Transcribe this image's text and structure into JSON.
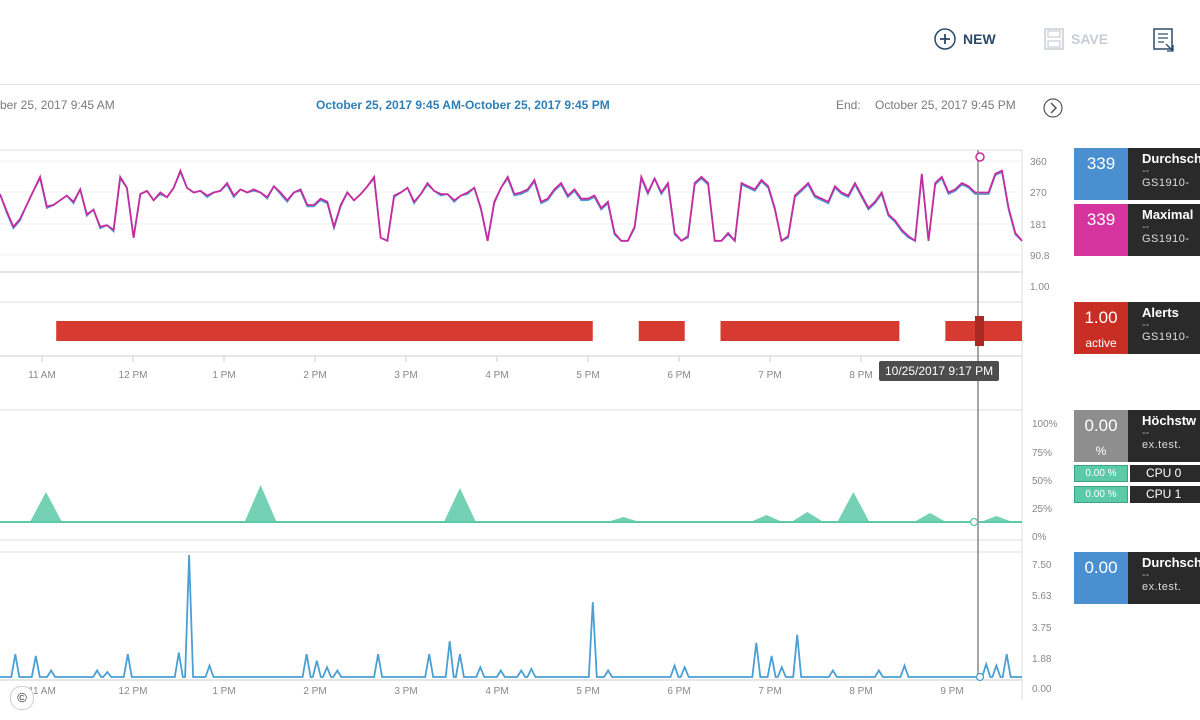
{
  "toolbar": {
    "new_label": "NEW",
    "save_label": "SAVE"
  },
  "timerange": {
    "start_text": "ber 25, 2017 9:45 AM",
    "center_text": "October 25, 2017 9:45 AM-October 25, 2017 9:45 PM",
    "end_label": "End:",
    "end_text": "October 25, 2017 9:45 PM"
  },
  "charts": {
    "metric": {
      "y_ticks": [
        "360",
        "270",
        "181",
        "90.8"
      ],
      "alerts_tick": "1.00",
      "avg_color": "#4a9fd4",
      "max_color": "#c62ba0",
      "avg_values": [
        250,
        190,
        140,
        165,
        215,
        260,
        300,
        205,
        215,
        230,
        245,
        220,
        265,
        180,
        200,
        140,
        150,
        130,
        300,
        270,
        110,
        250,
        260,
        230,
        250,
        240,
        270,
        320,
        270,
        255,
        260,
        240,
        255,
        260,
        280,
        240,
        265,
        255,
        260,
        255,
        235,
        275,
        250,
        225,
        255,
        260,
        210,
        210,
        230,
        220,
        140,
        210,
        255,
        230,
        250,
        275,
        300,
        110,
        100,
        240,
        255,
        270,
        220,
        250,
        280,
        260,
        245,
        250,
        225,
        245,
        250,
        270,
        200,
        100,
        220,
        270,
        300,
        245,
        250,
        260,
        290,
        220,
        230,
        260,
        280,
        240,
        260,
        230,
        230,
        240,
        200,
        220,
        120,
        100,
        100,
        140,
        300,
        250,
        300,
        250,
        280,
        120,
        100,
        110,
        280,
        300,
        280,
        100,
        100,
        120,
        100,
        280,
        270,
        260,
        290,
        270,
        200,
        100,
        110,
        240,
        260,
        280,
        240,
        230,
        220,
        270,
        250,
        240,
        280,
        240,
        200,
        220,
        250,
        180,
        160,
        130,
        110,
        100,
        310,
        100,
        280,
        300,
        250,
        260,
        280,
        270,
        250,
        250,
        250,
        310,
        320,
        200,
        120,
        100
      ],
      "max_values": [
        250,
        195,
        145,
        170,
        215,
        260,
        305,
        210,
        215,
        230,
        245,
        225,
        265,
        185,
        200,
        145,
        150,
        135,
        305,
        270,
        110,
        250,
        260,
        230,
        255,
        240,
        270,
        325,
        270,
        255,
        260,
        245,
        255,
        260,
        285,
        245,
        265,
        255,
        265,
        255,
        240,
        275,
        255,
        230,
        255,
        265,
        215,
        215,
        235,
        225,
        145,
        215,
        255,
        230,
        250,
        275,
        305,
        110,
        100,
        245,
        255,
        270,
        225,
        250,
        285,
        260,
        250,
        250,
        230,
        245,
        255,
        270,
        205,
        100,
        225,
        270,
        305,
        250,
        255,
        265,
        295,
        225,
        235,
        265,
        285,
        245,
        265,
        235,
        235,
        245,
        205,
        225,
        125,
        100,
        100,
        145,
        305,
        255,
        300,
        255,
        285,
        125,
        100,
        115,
        285,
        305,
        285,
        100,
        100,
        125,
        100,
        285,
        275,
        265,
        295,
        275,
        205,
        100,
        115,
        245,
        265,
        285,
        245,
        235,
        225,
        275,
        255,
        245,
        285,
        245,
        205,
        225,
        255,
        185,
        165,
        135,
        115,
        100,
        315,
        100,
        285,
        305,
        255,
        265,
        285,
        275,
        255,
        255,
        255,
        315,
        325,
        205,
        125,
        100
      ],
      "alert_segments": [
        [
          0.055,
          0.58
        ],
        [
          0.625,
          0.67
        ],
        [
          0.705,
          0.88
        ],
        [
          0.925,
          1.0
        ]
      ],
      "alert_color": "#d63a30"
    },
    "timeline_ticks": [
      "11 AM",
      "12 PM",
      "1 PM",
      "2 PM",
      "3 PM",
      "4 PM",
      "5 PM",
      "6 PM",
      "7 PM",
      "8 PM"
    ],
    "tooltip": "10/25/2017 9:17 PM",
    "cpu": {
      "y_ticks": [
        "100%",
        "75%",
        "50%",
        "25%",
        "0%"
      ],
      "color": "#5cc9a7",
      "peaks": [
        [
          0.045,
          30
        ],
        [
          0.255,
          37
        ],
        [
          0.45,
          34
        ],
        [
          0.61,
          5
        ],
        [
          0.75,
          7
        ],
        [
          0.79,
          10
        ],
        [
          0.835,
          30
        ],
        [
          0.91,
          9
        ],
        [
          0.975,
          6
        ]
      ]
    },
    "io": {
      "y_ticks": [
        "7.50",
        "5.63",
        "3.75",
        "1.88",
        "0.00"
      ],
      "color": "#4a9fd4",
      "bottom_ticks": [
        "11 AM",
        "12 PM",
        "1 PM",
        "2 PM",
        "3 PM",
        "4 PM",
        "5 PM",
        "6 PM",
        "7 PM",
        "8 PM",
        "9 PM"
      ],
      "spikes": [
        [
          0.015,
          1.4
        ],
        [
          0.035,
          1.3
        ],
        [
          0.05,
          0.4
        ],
        [
          0.095,
          0.4
        ],
        [
          0.105,
          0.3
        ],
        [
          0.125,
          1.4
        ],
        [
          0.175,
          1.5
        ],
        [
          0.185,
          7.5
        ],
        [
          0.205,
          0.7
        ],
        [
          0.3,
          1.4
        ],
        [
          0.31,
          1.0
        ],
        [
          0.32,
          0.6
        ],
        [
          0.33,
          0.4
        ],
        [
          0.37,
          1.4
        ],
        [
          0.42,
          1.4
        ],
        [
          0.44,
          2.2
        ],
        [
          0.45,
          1.4
        ],
        [
          0.47,
          0.6
        ],
        [
          0.49,
          0.4
        ],
        [
          0.51,
          0.4
        ],
        [
          0.52,
          0.5
        ],
        [
          0.58,
          4.6
        ],
        [
          0.595,
          0.4
        ],
        [
          0.66,
          0.7
        ],
        [
          0.67,
          0.6
        ],
        [
          0.74,
          2.1
        ],
        [
          0.755,
          1.3
        ],
        [
          0.765,
          0.6
        ],
        [
          0.78,
          2.6
        ],
        [
          0.815,
          0.4
        ],
        [
          0.86,
          0.4
        ],
        [
          0.885,
          0.7
        ],
        [
          0.965,
          0.8
        ],
        [
          0.975,
          0.7
        ],
        [
          0.985,
          1.4
        ]
      ]
    }
  },
  "side_panels": {
    "avg_value": "339",
    "avg_title": "Durchschn",
    "avg_dash": "--",
    "avg_source": "GS1910-",
    "max_value": "339",
    "max_title": "Maximal",
    "max_dash": "--",
    "max_source": "GS1910-",
    "alerts_value": "1.00",
    "alerts_sub": "active",
    "alerts_title": "Alerts",
    "alerts_dash": "--",
    "alerts_source": "GS1910-",
    "cpu_value": "0.00",
    "cpu_sub": "%",
    "cpu_title": "Höchstw",
    "cpu_dash": "--",
    "cpu_source": "ex.test.",
    "cpu0_badge": "0.00 %",
    "cpu0_label": "CPU 0",
    "cpu1_badge": "0.00 %",
    "cpu1_label": "CPU 1",
    "io_value": "0.00",
    "io_title": "Durchsch",
    "io_dash": "--",
    "io_source": "ex.test."
  },
  "copyright_symbol": "©"
}
